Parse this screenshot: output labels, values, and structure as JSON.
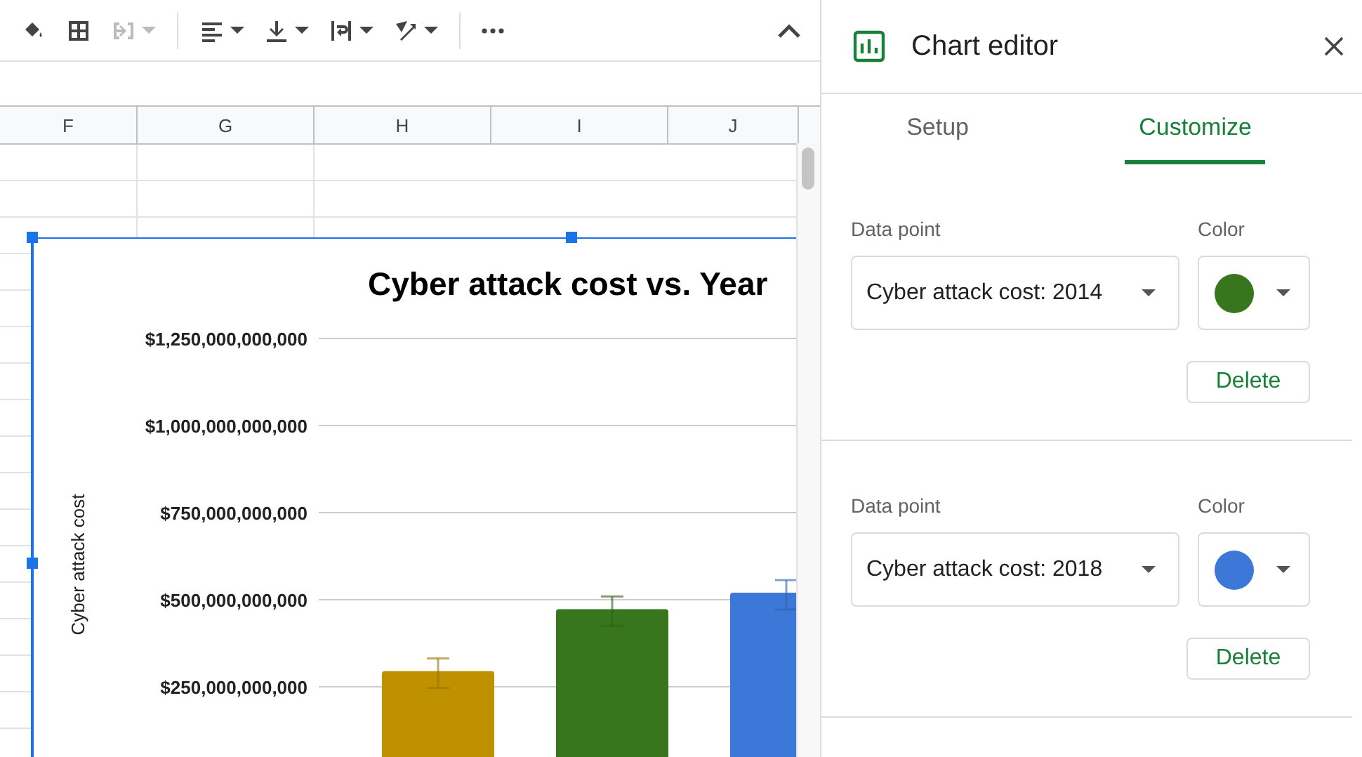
{
  "toolbar": {
    "items": [
      {
        "kind": "fill",
        "disabled": false,
        "menu": false
      },
      {
        "kind": "borders",
        "disabled": false,
        "menu": false
      },
      {
        "kind": "merge",
        "disabled": true,
        "menu": true
      },
      {
        "kind": "separator"
      },
      {
        "kind": "align",
        "disabled": false,
        "menu": true
      },
      {
        "kind": "valign",
        "disabled": false,
        "menu": true
      },
      {
        "kind": "wrap",
        "disabled": false,
        "menu": true
      },
      {
        "kind": "rotate",
        "disabled": false,
        "menu": true
      },
      {
        "kind": "separator"
      },
      {
        "kind": "more",
        "disabled": false,
        "menu": false
      }
    ]
  },
  "columns": [
    "F",
    "G",
    "H",
    "I",
    "J"
  ],
  "chart": {
    "chart_data": {
      "type": "bar",
      "grid": true,
      "title": "Cyber attack cost vs. Year",
      "ylabel": "Cyber attack cost",
      "ylim": [
        0,
        1250000000000
      ],
      "yticks": [
        {
          "value": 250000000000,
          "label": "$250,000,000,000"
        },
        {
          "value": 500000000000,
          "label": "$500,000,000,000"
        },
        {
          "value": 750000000000,
          "label": "$750,000,000,000"
        },
        {
          "value": 1000000000000,
          "label": "$1,000,000,000,000"
        },
        {
          "value": 1250000000000,
          "label": "$1,250,000,000,000"
        }
      ],
      "series": [
        {
          "color": "#bf9000",
          "values": [
            295000000000,
            null,
            null
          ]
        },
        {
          "color": "#38761d",
          "values": [
            null,
            473000000000,
            null
          ]
        },
        {
          "color": "#3c78d8",
          "values": [
            null,
            null,
            520000000000
          ]
        }
      ]
    }
  },
  "editor": {
    "title": "Chart editor",
    "tabs": [
      {
        "label": "Setup",
        "selected": false
      },
      {
        "label": "Customize",
        "selected": true
      }
    ],
    "data_points": [
      {
        "label": "Data point",
        "value": "Cyber attack cost: 2014",
        "color_label": "Color",
        "color": "#38761d",
        "delete": "Delete"
      },
      {
        "label": "Data point",
        "value": "Cyber attack cost: 2018",
        "color_label": "Color",
        "color": "#3c78d8",
        "delete": "Delete"
      }
    ]
  }
}
